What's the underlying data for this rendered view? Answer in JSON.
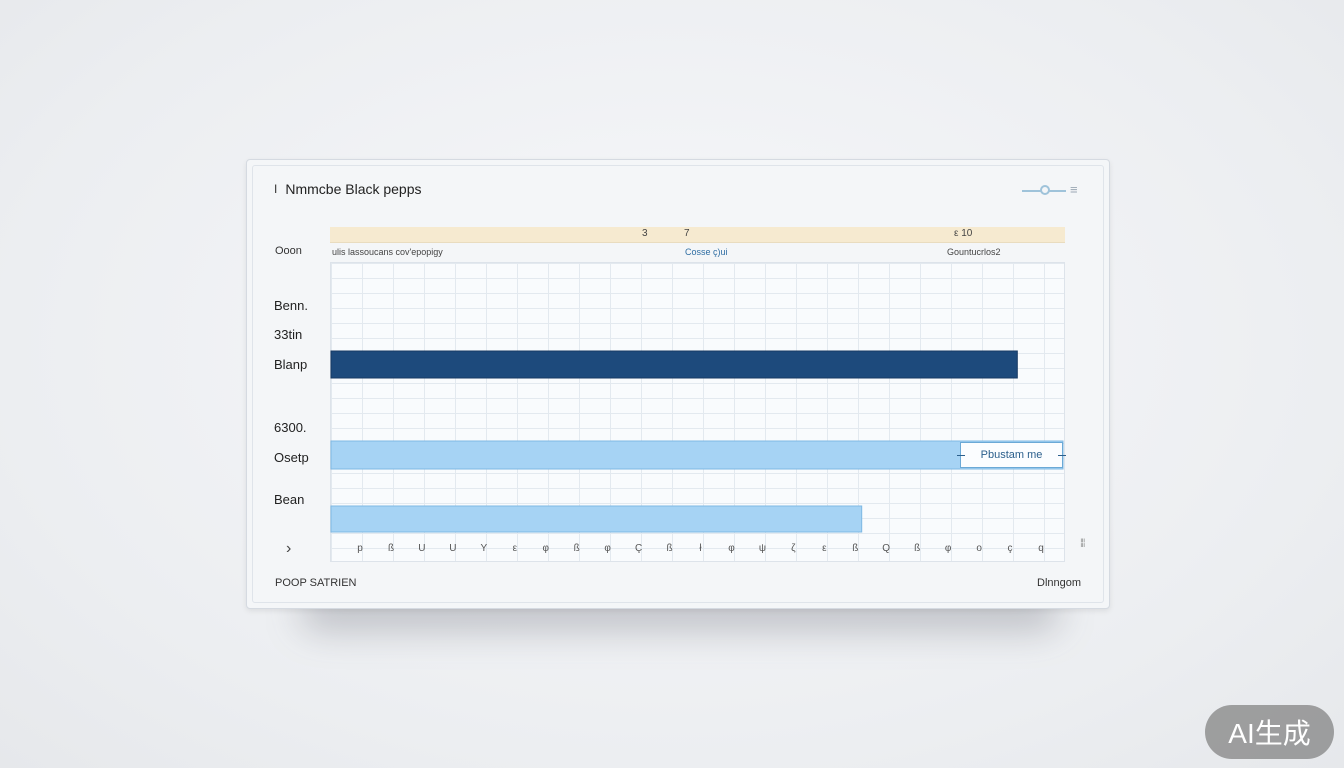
{
  "header": {
    "title": "Nmmcbe Black pepps",
    "title_icon": "I",
    "controls": [
      "slider-icon",
      "menu-icon"
    ],
    "menu_glyph": "≡"
  },
  "top_band": {
    "labels": [
      "3",
      "7",
      "ε  10"
    ],
    "color": "#f6ead0"
  },
  "column_headers": {
    "left": "ulis lassoucans cov'epopigy",
    "middle": "Cosse ç)ui",
    "right": "Gountucrlos2"
  },
  "row_header": "Ooon",
  "chart_data": {
    "type": "bar",
    "orientation": "horizontal",
    "category_labels": [
      "Benn.",
      "33tin",
      "Blanp",
      "6300.",
      "Osetp",
      "Bean"
    ],
    "bars": [
      {
        "row": "Blanp",
        "value": 22.5,
        "color": "#1d4a7c"
      },
      {
        "row": "Osetp",
        "value": 24.5,
        "color": "#a6d3f4",
        "annotation": "Pbustam me"
      },
      {
        "row": "Bean",
        "value": 17.4,
        "color": "#a6d3f4"
      }
    ],
    "x_tick_labels": [
      "р",
      "ß",
      "U",
      "U",
      "Y",
      "ε",
      "φ",
      "ß",
      "φ",
      "Ç",
      "ß",
      "ł",
      "φ",
      "ψ",
      "ζ",
      "ε",
      "ß",
      "Q",
      "ß",
      "φ",
      "ο",
      "ç",
      "q"
    ],
    "xlim": [
      0,
      24
    ],
    "grid": true
  },
  "chevron": "›",
  "side_mark": "≡≡",
  "footer": {
    "left": "POOP SATRIEN",
    "right": "Dlnngom"
  },
  "badge": "AI生成",
  "colors": {
    "dark_bar": "#1d4a7c",
    "light_bar": "#a6d3f4",
    "accent": "#2f6ea3"
  }
}
